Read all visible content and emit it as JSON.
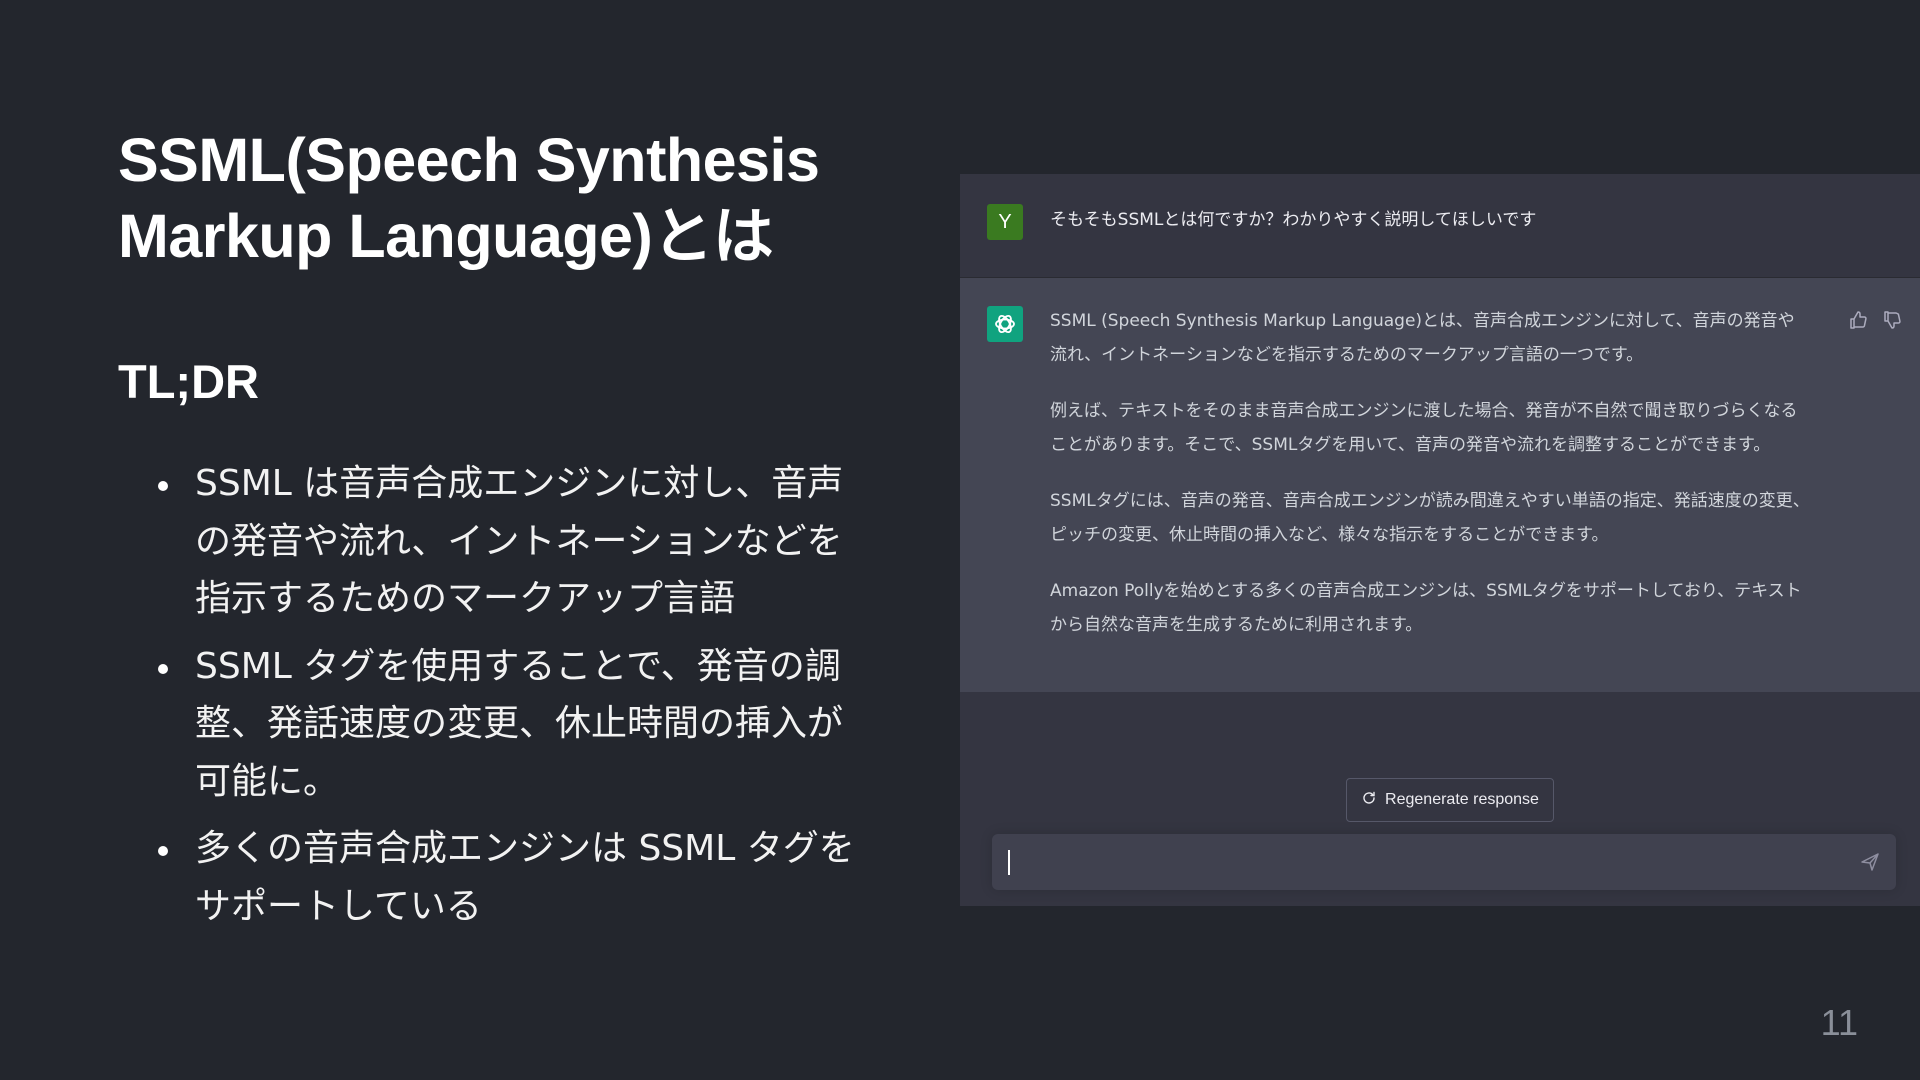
{
  "slide": {
    "title": "SSML(Speech Synthesis Markup Language)とは",
    "subheading": "TL;DR",
    "bullets": [
      "SSML は音声合成エンジンに対し、音声の発音や流れ、イントネーションなどを指示するためのマークアップ言語",
      "SSML タグを使用することで、発音の調整、発話速度の変更、休止時間の挿入が可能に。",
      "多くの音声合成エンジンは SSML タグをサポートしている"
    ],
    "page_number": "11"
  },
  "chat": {
    "user_avatar_letter": "Y",
    "user_message": "そもそもSSMLとは何ですか？わかりやすく説明してほしいです",
    "assistant_paragraphs": [
      "SSML (Speech Synthesis Markup Language)とは、音声合成エンジンに対して、音声の発音や流れ、イントネーションなどを指示するためのマークアップ言語の一つです。",
      "例えば、テキストをそのまま音声合成エンジンに渡した場合、発音が不自然で聞き取りづらくなることがあります。そこで、SSMLタグを用いて、音声の発音や流れを調整することができます。",
      "SSMLタグには、音声の発音、音声合成エンジンが読み間違えやすい単語の指定、発話速度の変更、ピッチの変更、休止時間の挿入など、様々な指示をすることができます。",
      "Amazon Pollyを始めとする多くの音声合成エンジンは、SSMLタグをサポートしており、テキストから自然な音声を生成するために利用されます。"
    ],
    "regenerate_label": "Regenerate response",
    "input_value": ""
  },
  "icons": {
    "openai_logo": "openai-logo-icon",
    "thumbs_up": "thumbs-up-icon",
    "thumbs_down": "thumbs-down-icon",
    "regenerate": "refresh-icon",
    "send": "send-icon"
  },
  "colors": {
    "background": "#23262d",
    "chat_user_bg": "#343541",
    "chat_ai_bg": "#444654",
    "user_avatar": "#3a7a20",
    "ai_avatar": "#10a37f",
    "input_bg": "#40414f"
  }
}
